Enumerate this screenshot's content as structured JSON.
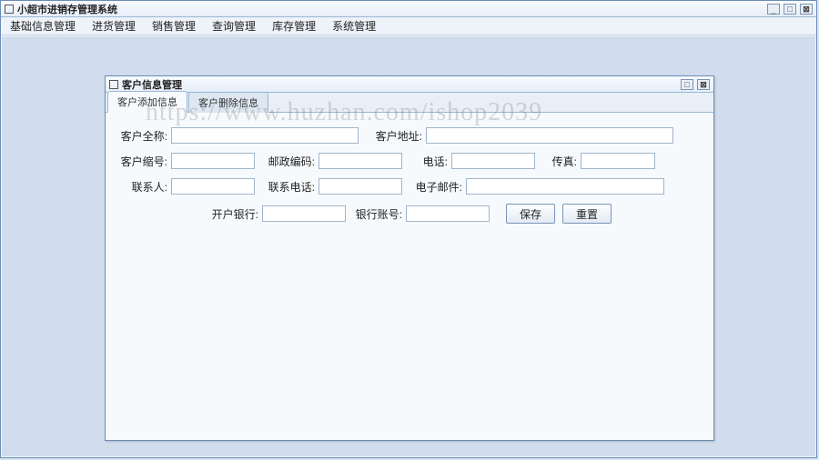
{
  "app": {
    "title": "小超市进销存管理系统"
  },
  "menu": {
    "basic": "基础信息管理",
    "purchase": "进货管理",
    "sales": "销售管理",
    "query": "查询管理",
    "stock": "库存管理",
    "system": "系统管理"
  },
  "dialog": {
    "title": "客户信息管理",
    "tab_add": "客户添加信息",
    "tab_del": "客户删除信息"
  },
  "form": {
    "full_name_lbl": "客户全称:",
    "full_name": "",
    "address_lbl": "客户地址:",
    "address": "",
    "short_name_lbl": "客户缩号:",
    "short_name": "",
    "zip_lbl": "邮政编码:",
    "zip": "",
    "phone_lbl": "电话:",
    "phone": "",
    "fax_lbl": "传真:",
    "fax": "",
    "contact_lbl": "联系人:",
    "contact": "",
    "contact_phone_lbl": "联系电话:",
    "contact_phone": "",
    "email_lbl": "电子邮件:",
    "email": "",
    "bank_lbl": "开户银行:",
    "bank": "",
    "account_lbl": "银行账号:",
    "account": "",
    "save_btn": "保存",
    "reset_btn": "重置"
  },
  "watermark": "https://www.huzhan.com/ishop2039"
}
